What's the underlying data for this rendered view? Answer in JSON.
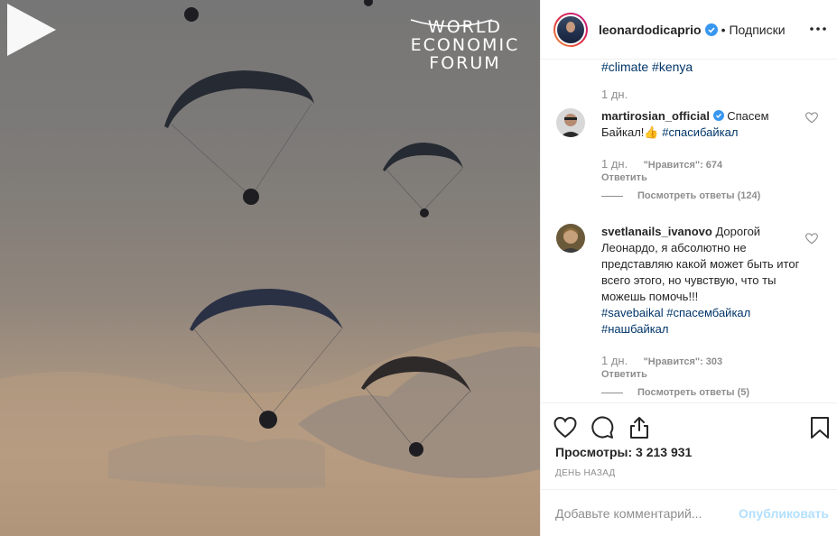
{
  "media": {
    "logo_lines": [
      "WORLD",
      "ECONOMIC",
      "FORUM"
    ]
  },
  "header": {
    "username": "leonardodicaprio",
    "separator": "•",
    "follow_label": "Подписки"
  },
  "caption_tail": {
    "tag1": "#climate",
    "tag2": "#kenya",
    "time": "1 дн."
  },
  "comments": [
    {
      "username": "martirosian_official",
      "verified": true,
      "text": "Спасем Байкал!👍",
      "tags": "#спасибайкал",
      "time": "1 дн.",
      "likes": "\"Нравится\": 674",
      "reply": "Ответить",
      "view_replies": "Посмотреть ответы (124)"
    },
    {
      "username": "svetlanails_ivanovo",
      "verified": false,
      "text": "Дорогой Леонардо, я абсолютно не представляю какой может быть итог всего этого, но чувствую, что ты можешь помочь!!!",
      "tags": [
        "#savebaikal",
        "#спасембайкал",
        "#нашбайкал"
      ],
      "time": "1 дн.",
      "likes": "\"Нравится\": 303",
      "reply": "Ответить",
      "view_replies": "Посмотреть ответы (5)"
    }
  ],
  "stats": {
    "views": "Просмотры: 3 213 931",
    "posted": "ДЕНЬ НАЗАД"
  },
  "add_comment": {
    "placeholder": "Добавьте комментарий...",
    "publish_label": "Опубликовать"
  },
  "colors": {
    "link": "#003569",
    "verified": "#3897f0",
    "publish_disabled": "#b2dffc"
  },
  "icons": [
    "wef-logo",
    "play-icon",
    "verified-badge-icon",
    "more-options-icon",
    "heart-icon",
    "comment-icon",
    "share-icon",
    "bookmark-icon"
  ]
}
